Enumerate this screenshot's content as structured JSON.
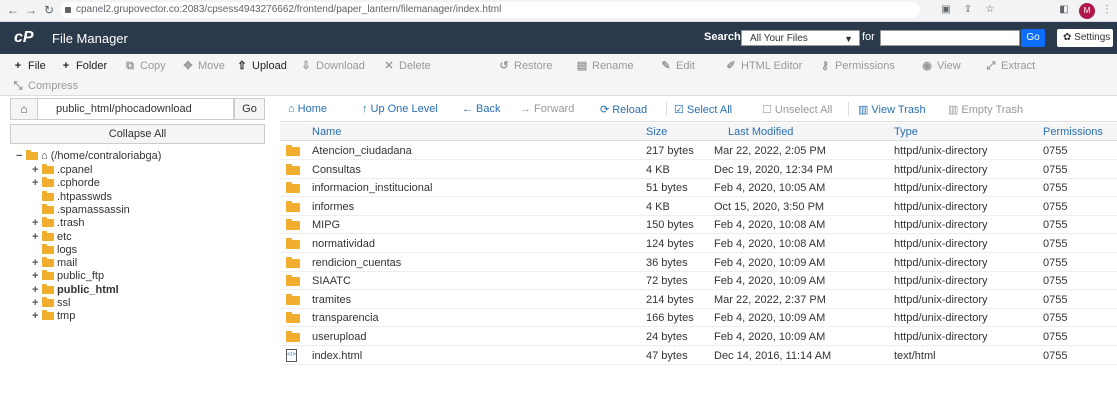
{
  "browser": {
    "url": "cpanel2.grupovector.co:2083/cpsess4943276662/frontend/paper_lantern/filemanager/index.html",
    "profile_initials": "M"
  },
  "header": {
    "logo": "cP",
    "title": "File Manager",
    "search_label": "Search",
    "search_scope": "All Your Files",
    "for_label": "for",
    "search_value": "",
    "go_label": "Go",
    "settings_label": "Settings"
  },
  "toolbar": {
    "file": "File",
    "folder": "Folder",
    "copy": "Copy",
    "move": "Move",
    "upload": "Upload",
    "download": "Download",
    "delete": "Delete",
    "restore": "Restore",
    "rename": "Rename",
    "edit": "Edit",
    "html_editor": "HTML Editor",
    "permissions": "Permissions",
    "view": "View",
    "extract": "Extract",
    "compress": "Compress"
  },
  "sidebar": {
    "path": "public_html/phocadownload",
    "go_label": "Go",
    "collapse_label": "Collapse All",
    "root": "(/home/contraloriabga)",
    "items": [
      {
        "label": ".cpanel",
        "toggle": "+",
        "bold": false
      },
      {
        "label": ".cphorde",
        "toggle": "+",
        "bold": false
      },
      {
        "label": ".htpasswds",
        "toggle": "",
        "bold": false
      },
      {
        "label": ".spamassassin",
        "toggle": "",
        "bold": false
      },
      {
        "label": ".trash",
        "toggle": "+",
        "bold": false
      },
      {
        "label": "etc",
        "toggle": "+",
        "bold": false
      },
      {
        "label": "logs",
        "toggle": "",
        "bold": false
      },
      {
        "label": "mail",
        "toggle": "+",
        "bold": false
      },
      {
        "label": "public_ftp",
        "toggle": "+",
        "bold": false
      },
      {
        "label": "public_html",
        "toggle": "+",
        "bold": true
      },
      {
        "label": "ssl",
        "toggle": "+",
        "bold": false
      },
      {
        "label": "tmp",
        "toggle": "+",
        "bold": false
      }
    ]
  },
  "nav": {
    "home": "Home",
    "up": "Up One Level",
    "back": "Back",
    "forward": "Forward",
    "reload": "Reload",
    "select_all": "Select All",
    "unselect_all": "Unselect All",
    "view_trash": "View Trash",
    "empty_trash": "Empty Trash"
  },
  "table": {
    "columns": [
      "Name",
      "Size",
      "Last Modified",
      "Type",
      "Permissions"
    ],
    "rows": [
      {
        "icon": "folder",
        "name": "Atencion_ciudadana",
        "size": "217 bytes",
        "modified": "Mar 22, 2022, 2:05 PM",
        "type": "httpd/unix-directory",
        "perms": "0755"
      },
      {
        "icon": "folder",
        "name": "Consultas",
        "size": "4 KB",
        "modified": "Dec 19, 2020, 12:34 PM",
        "type": "httpd/unix-directory",
        "perms": "0755"
      },
      {
        "icon": "folder",
        "name": "informacion_institucional",
        "size": "51 bytes",
        "modified": "Feb 4, 2020, 10:05 AM",
        "type": "httpd/unix-directory",
        "perms": "0755"
      },
      {
        "icon": "folder",
        "name": "informes",
        "size": "4 KB",
        "modified": "Oct 15, 2020, 3:50 PM",
        "type": "httpd/unix-directory",
        "perms": "0755"
      },
      {
        "icon": "folder",
        "name": "MIPG",
        "size": "150 bytes",
        "modified": "Feb 4, 2020, 10:08 AM",
        "type": "httpd/unix-directory",
        "perms": "0755"
      },
      {
        "icon": "folder",
        "name": "normatividad",
        "size": "124 bytes",
        "modified": "Feb 4, 2020, 10:08 AM",
        "type": "httpd/unix-directory",
        "perms": "0755"
      },
      {
        "icon": "folder",
        "name": "rendicion_cuentas",
        "size": "36 bytes",
        "modified": "Feb 4, 2020, 10:09 AM",
        "type": "httpd/unix-directory",
        "perms": "0755"
      },
      {
        "icon": "folder",
        "name": "SIAATC",
        "size": "72 bytes",
        "modified": "Feb 4, 2020, 10:09 AM",
        "type": "httpd/unix-directory",
        "perms": "0755"
      },
      {
        "icon": "folder",
        "name": "tramites",
        "size": "214 bytes",
        "modified": "Mar 22, 2022, 2:37 PM",
        "type": "httpd/unix-directory",
        "perms": "0755"
      },
      {
        "icon": "folder",
        "name": "transparencia",
        "size": "166 bytes",
        "modified": "Feb 4, 2020, 10:09 AM",
        "type": "httpd/unix-directory",
        "perms": "0755"
      },
      {
        "icon": "folder",
        "name": "userupload",
        "size": "24 bytes",
        "modified": "Feb 4, 2020, 10:09 AM",
        "type": "httpd/unix-directory",
        "perms": "0755"
      },
      {
        "icon": "html",
        "name": "index.html",
        "size": "47 bytes",
        "modified": "Dec 14, 2016, 11:14 AM",
        "type": "text/html",
        "perms": "0755"
      }
    ]
  }
}
